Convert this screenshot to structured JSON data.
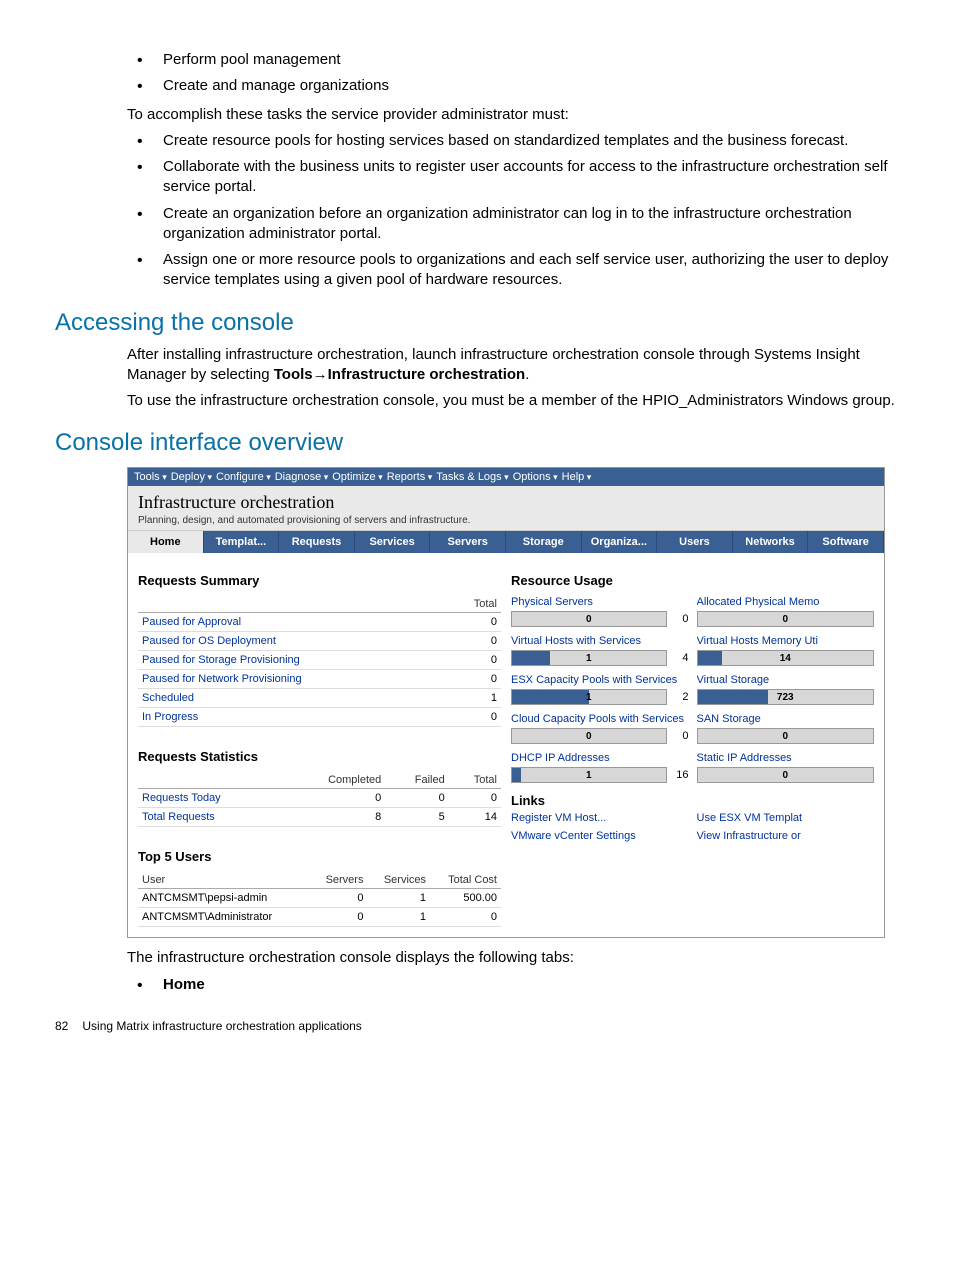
{
  "intro_bullets_top": [
    "Perform pool management",
    "Create and manage organizations"
  ],
  "intro_para": "To accomplish these tasks the service provider administrator must:",
  "intro_bullets_mid": [
    "Create resource pools for hosting services based on standardized templates and the business forecast.",
    "Collaborate with the business units to register user accounts for access to the infrastructure orchestration self service portal.",
    "Create an organization before an organization administrator can log in to the infrastructure orchestration organization administrator portal.",
    "Assign one or more resource pools to organizations and each self service user, authorizing the user to deploy service templates using a given pool of hardware resources."
  ],
  "heading_access": "Accessing the console",
  "access_p1_a": "After installing infrastructure orchestration, launch infrastructure orchestration console through Systems Insight Manager by selecting ",
  "access_p1_b": "Tools",
  "access_p1_c": "→",
  "access_p1_d": "Infrastructure orchestration",
  "access_p1_e": ".",
  "access_p2": "To use the infrastructure orchestration console, you must be a member of the HPIO_Administrators Windows group.",
  "heading_overview": "Console interface overview",
  "screenshot": {
    "menubar": [
      "Tools",
      "Deploy",
      "Configure",
      "Diagnose",
      "Optimize",
      "Reports",
      "Tasks & Logs",
      "Options",
      "Help"
    ],
    "title": "Infrastructure orchestration",
    "subtitle": "Planning, design, and automated provisioning of servers and infrastructure.",
    "tabs": [
      "Home",
      "Templat...",
      "Requests",
      "Services",
      "Servers",
      "Storage",
      "Organiza...",
      "Users",
      "Networks",
      "Software"
    ],
    "active_tab": 0,
    "req_summary": {
      "title": "Requests Summary",
      "col": "Total",
      "rows": [
        {
          "label": "Paused for Approval",
          "val": "0"
        },
        {
          "label": "Paused for OS Deployment",
          "val": "0"
        },
        {
          "label": "Paused for Storage Provisioning",
          "val": "0"
        },
        {
          "label": "Paused for Network Provisioning",
          "val": "0"
        },
        {
          "label": "Scheduled",
          "val": "1"
        },
        {
          "label": "In Progress",
          "val": "0"
        }
      ]
    },
    "req_stats": {
      "title": "Requests Statistics",
      "cols": [
        "Completed",
        "Failed",
        "Total"
      ],
      "rows": [
        {
          "label": "Requests Today",
          "vals": [
            "0",
            "0",
            "0"
          ]
        },
        {
          "label": "Total Requests",
          "vals": [
            "8",
            "5",
            "14"
          ]
        }
      ]
    },
    "top_users": {
      "title": "Top 5 Users",
      "cols": [
        "User",
        "Servers",
        "Services",
        "Total Cost"
      ],
      "rows": [
        {
          "vals": [
            "ANTCMSMT\\pepsi-admin",
            "0",
            "1",
            "500.00"
          ]
        },
        {
          "vals": [
            "ANTCMSMT\\Administrator",
            "0",
            "1",
            "0"
          ]
        }
      ]
    },
    "resource_usage": {
      "title": "Resource Usage",
      "items": [
        {
          "label": "Physical Servers",
          "value": "0",
          "total": "0",
          "pct": 0
        },
        {
          "label": "Allocated Physical Memo",
          "value": "0",
          "total": "",
          "pct": 0
        },
        {
          "label": "Virtual Hosts with Services",
          "value": "1",
          "total": "4",
          "pct": 25
        },
        {
          "label": "Virtual Hosts Memory Uti",
          "value": "14",
          "total": "",
          "pct": 14
        },
        {
          "label": "ESX Capacity Pools with Services",
          "value": "1",
          "total": "2",
          "pct": 50
        },
        {
          "label": "Virtual Storage",
          "value": "723",
          "total": "",
          "pct": 40
        },
        {
          "label": "Cloud Capacity Pools with Services",
          "value": "0",
          "total": "0",
          "pct": 0
        },
        {
          "label": "SAN Storage",
          "value": "0",
          "total": "",
          "pct": 0
        },
        {
          "label": "DHCP IP Addresses",
          "value": "1",
          "total": "16",
          "pct": 6
        },
        {
          "label": "Static IP Addresses",
          "value": "0",
          "total": "",
          "pct": 0
        }
      ]
    },
    "links": {
      "title": "Links",
      "items": [
        "Register VM Host...",
        "Use ESX VM Templat",
        "VMware vCenter Settings",
        "View Infrastructure or"
      ]
    }
  },
  "outro_para": "The infrastructure orchestration console displays the following tabs:",
  "outro_bullet": "Home",
  "footer_page": "82",
  "footer_text": "Using Matrix infrastructure orchestration applications"
}
